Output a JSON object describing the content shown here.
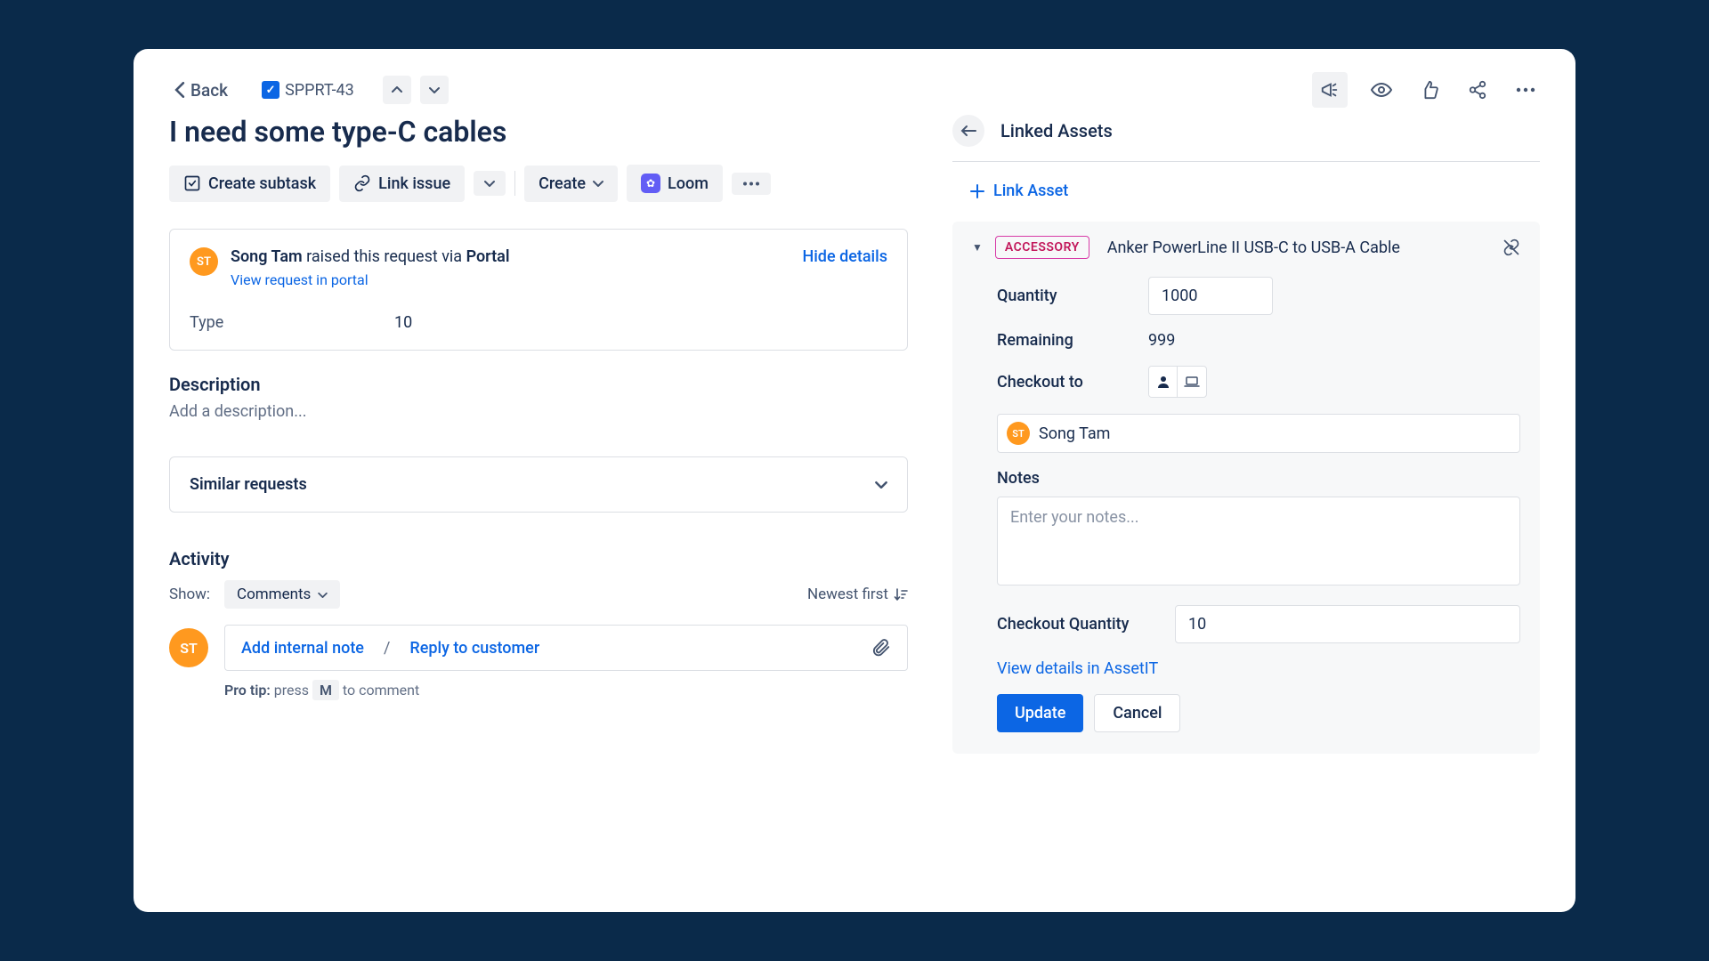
{
  "topbar": {
    "back_label": "Back",
    "issue_key": "SPPRT-43"
  },
  "issue": {
    "title": "I need some type-C cables"
  },
  "actions": {
    "create_subtask": "Create subtask",
    "link_issue": "Link issue",
    "create": "Create",
    "loom": "Loom"
  },
  "request": {
    "user_initials": "ST",
    "user_name": "Song Tam",
    "raised_text": " raised this request via ",
    "via": "Portal",
    "view_portal": "View request in portal",
    "hide_details": "Hide details",
    "type_label": "Type",
    "type_value": "10"
  },
  "description": {
    "heading": "Description",
    "placeholder": "Add a description..."
  },
  "similar": {
    "title": "Similar requests"
  },
  "activity": {
    "heading": "Activity",
    "show_label": "Show:",
    "filter": "Comments",
    "newest": "Newest first",
    "add_internal": "Add internal note",
    "reply": "Reply to customer",
    "pro_tip_label": "Pro tip:",
    "pro_tip_press": " press ",
    "pro_tip_key": "M",
    "pro_tip_after": " to comment",
    "avatar_initials": "ST"
  },
  "linked": {
    "title": "Linked Assets",
    "link_asset": "Link Asset"
  },
  "asset": {
    "tag": "ACCESSORY",
    "name": "Anker PowerLine II USB-C to USB-A Cable",
    "quantity_label": "Quantity",
    "quantity_value": "1000",
    "remaining_label": "Remaining",
    "remaining_value": "999",
    "checkout_to_label": "Checkout to",
    "checkout_user_initials": "ST",
    "checkout_user_name": "Song Tam",
    "notes_label": "Notes",
    "notes_placeholder": "Enter your notes...",
    "checkout_qty_label": "Checkout Quantity",
    "checkout_qty_value": "10",
    "view_details": "View details in AssetIT",
    "update_btn": "Update",
    "cancel_btn": "Cancel"
  }
}
